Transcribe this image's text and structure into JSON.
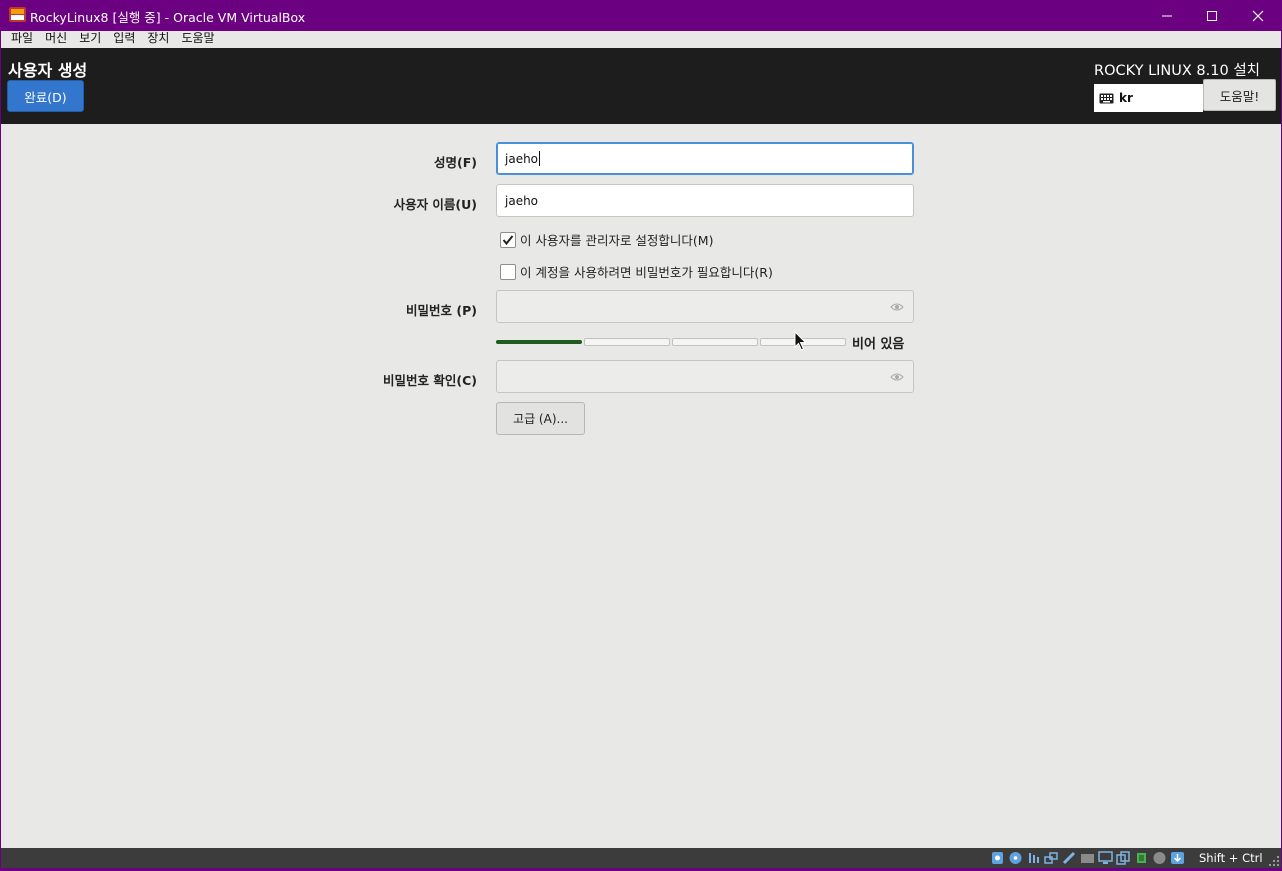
{
  "window": {
    "title": "RockyLinux8 [실행 중] - Oracle VM VirtualBox"
  },
  "menu": {
    "items": [
      "파일",
      "머신",
      "보기",
      "입력",
      "장치",
      "도움말"
    ]
  },
  "header": {
    "page_title": "사용자 생성",
    "done_label": "완료(D)",
    "install_title": "ROCKY LINUX 8.10 설치",
    "keyboard_layout": "kr",
    "help_label": "도움말!"
  },
  "form": {
    "fullname_label": "성명(F)",
    "fullname_value": "jaeho",
    "username_label": "사용자 이름(U)",
    "username_value": "jaeho",
    "admin_label": "이 사용자를 관리자로 설정합니다(M)",
    "admin_checked": true,
    "require_password_label": "이 계정을 사용하려면 비밀번호가 필요합니다(R)",
    "require_password_checked": false,
    "password_label": "비밀번호 (P)",
    "password_value": "",
    "strength_text": "비어 있음",
    "strength_level": 0.25,
    "confirm_label": "비밀번호 확인(C)",
    "confirm_value": "",
    "advanced_label": "고급 (A)..."
  },
  "statusbar": {
    "host_key": "Shift + Ctrl"
  },
  "colors": {
    "titlebar": "#6b0080",
    "header": "#1d1d1d",
    "done_button": "#3276cd",
    "strength_fill": "#1f5c1f"
  }
}
